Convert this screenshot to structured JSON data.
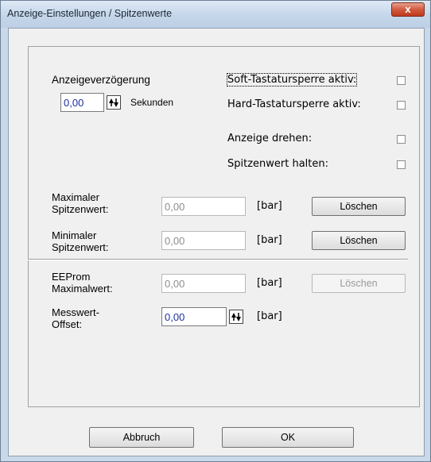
{
  "window": {
    "title": "Anzeige-Einstellungen / Spitzenwerte",
    "close_glyph": "x"
  },
  "display_delay": {
    "label": "Anzeigeverzögerung",
    "value": "0,00",
    "unit": "Sekunden"
  },
  "options": [
    {
      "label": "Soft-Tastatursperre aktiv:",
      "checked": false
    },
    {
      "label": "Hard-Tastatursperre aktiv:",
      "checked": false
    },
    {
      "label": "Anzeige drehen:",
      "checked": false
    },
    {
      "label": "Spitzenwert halten:",
      "checked": false
    }
  ],
  "max_peak": {
    "label_line1": "Maximaler",
    "label_line2": "Spitzenwert:",
    "value": "0,00",
    "unit": "[bar]",
    "button": "Löschen"
  },
  "min_peak": {
    "label_line1": "Minimaler",
    "label_line2": "Spitzenwert:",
    "value": "0,00",
    "unit": "[bar]",
    "button": "Löschen"
  },
  "eeprom_max": {
    "label_line1": "EEProm",
    "label_line2": "Maximalwert:",
    "value": "0,00",
    "unit": "[bar]",
    "button": "Löschen"
  },
  "offset": {
    "label_line1": "Messwert-",
    "label_line2": "Offset:",
    "value": "0,00",
    "unit": "[bar]"
  },
  "footer": {
    "cancel_label": "Abbruch",
    "ok_label": "OK"
  }
}
